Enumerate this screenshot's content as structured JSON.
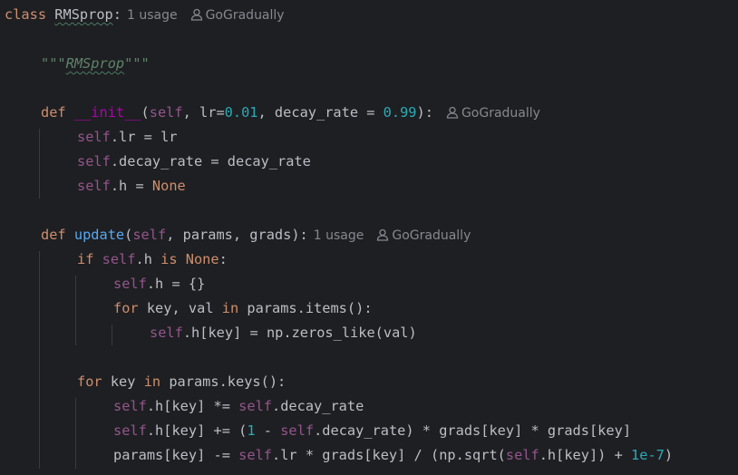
{
  "editor": {
    "class_line": {
      "keyword": "class",
      "name": "RMSprop",
      "colon": ":",
      "usage_hint": "1 usage",
      "author_hint": "GoGradually"
    },
    "docstring": {
      "open_quotes": "\"\"\"",
      "text": "RMSprop",
      "close_quotes": "\"\"\""
    },
    "init_def": {
      "keyword": "def",
      "name": "__init__",
      "p_open": "(",
      "self": "self",
      "mid": ", lr=",
      "lr_default": "0.01",
      "mid2": ", decay_rate = ",
      "decay_default": "0.99",
      "p_close": "):",
      "author_hint": "GoGradually"
    },
    "init_body": [
      {
        "self": "self",
        "code": ".lr = lr"
      },
      {
        "self": "self",
        "code": ".decay_rate = decay_rate"
      },
      {
        "self": "self",
        "code": ".h = ",
        "keyword": "None"
      }
    ],
    "update_def": {
      "keyword": "def",
      "name": "update",
      "p_open": "(",
      "self": "self",
      "rest": ", params, grads):",
      "usage_hint": "1 usage",
      "author_hint": "GoGradually"
    },
    "if_line": {
      "kw_if": "if",
      "self": "self",
      "mid": ".h ",
      "kw_is": "is",
      "kw_none": "None",
      "colon": ":"
    },
    "h_init": {
      "self": "self",
      "code": ".h = {}"
    },
    "for_items": {
      "kw_for": "for",
      "vars": " key, val ",
      "kw_in": "in",
      "rest": " params.items():"
    },
    "zeros_line": {
      "self": "self",
      "code": ".h[key] = np.zeros_like(val)"
    },
    "for_keys": {
      "kw_for": "for",
      "vars": " key ",
      "kw_in": "in",
      "rest": " params.keys():"
    },
    "decay_line": {
      "self1": "self",
      "mid": ".h[key] *= ",
      "self2": "self",
      "end": ".decay_rate"
    },
    "accum_line": {
      "self1": "self",
      "mid": ".h[key] += (",
      "one": "1",
      "mid2": " - ",
      "self2": "self",
      "end": ".decay_rate) * grads[key] * grads[key]"
    },
    "param_line": {
      "start": "params[key] -= ",
      "self1": "self",
      "mid": ".lr * grads[key] / (np.sqrt(",
      "self2": "self",
      "mid2": ".h[key]) + ",
      "eps": "1e-7",
      "end": ")"
    },
    "colors": {
      "background": "#1e1f22",
      "keyword": "#cf8e6d",
      "self": "#94558d",
      "number": "#2aacb8",
      "function": "#56a8f5",
      "docstring": "#5f826b",
      "hint": "#86888e",
      "text": "#bcbec4"
    }
  }
}
